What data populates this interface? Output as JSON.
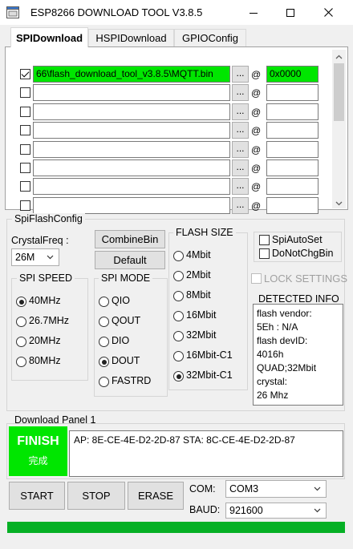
{
  "window": {
    "title": "ESP8266 DOWNLOAD TOOL V3.8.5",
    "minimize_label": "minimize",
    "maximize_label": "maximize",
    "close_label": "close"
  },
  "tabs": [
    {
      "label": "SPIDownload",
      "active": true
    },
    {
      "label": "HSPIDownload",
      "active": false
    },
    {
      "label": "GPIOConfig",
      "active": false
    }
  ],
  "file_rows": [
    {
      "checked": true,
      "path": "66\\flash_download_tool_v3.8.5\\MQTT.bin",
      "browse": "...",
      "at": "@",
      "address": "0x0000"
    },
    {
      "checked": false,
      "path": "",
      "browse": "...",
      "at": "@",
      "address": ""
    },
    {
      "checked": false,
      "path": "",
      "browse": "...",
      "at": "@",
      "address": ""
    },
    {
      "checked": false,
      "path": "",
      "browse": "...",
      "at": "@",
      "address": ""
    },
    {
      "checked": false,
      "path": "",
      "browse": "...",
      "at": "@",
      "address": ""
    },
    {
      "checked": false,
      "path": "",
      "browse": "...",
      "at": "@",
      "address": ""
    },
    {
      "checked": false,
      "path": "",
      "browse": "...",
      "at": "@",
      "address": ""
    },
    {
      "checked": false,
      "path": "",
      "browse": "...",
      "at": "@",
      "address": ""
    }
  ],
  "spi_flash_config": {
    "group_title": "SpiFlashConfig",
    "crystal_label": "CrystalFreq :",
    "crystal_value": "26M",
    "combine_bin": "CombineBin",
    "default": "Default",
    "spi_speed": {
      "title": "SPI SPEED",
      "options": [
        "40MHz",
        "26.7MHz",
        "20MHz",
        "80MHz"
      ],
      "selected": "40MHz"
    },
    "spi_mode": {
      "title": "SPI MODE",
      "options": [
        "QIO",
        "QOUT",
        "DIO",
        "DOUT",
        "FASTRD"
      ],
      "selected": "DOUT"
    },
    "flash_size": {
      "title": "FLASH SIZE",
      "options": [
        "4Mbit",
        "2Mbit",
        "8Mbit",
        "16Mbit",
        "32Mbit",
        "16Mbit-C1",
        "32Mbit-C1"
      ],
      "selected": "32Mbit-C1"
    },
    "spi_auto_set": "SpiAutoSet",
    "do_not_chg_bin": "DoNotChgBin",
    "lock_settings": "LOCK SETTINGS",
    "detected_info": {
      "title": "DETECTED INFO",
      "lines": [
        "flash vendor:",
        "5Eh : N/A",
        "flash devID:",
        "4016h",
        "QUAD;32Mbit",
        "crystal:",
        "26 Mhz"
      ]
    }
  },
  "download_panel": {
    "title": "Download Panel 1",
    "status": "FINISH",
    "status_sub": "完成",
    "mac_info": "AP:  8E-CE-4E-D2-2D-87   STA:  8C-CE-4E-D2-2D-87"
  },
  "controls": {
    "start": "START",
    "stop": "STOP",
    "erase": "ERASE",
    "com_label": "COM:",
    "com_value": "COM3",
    "baud_label": "BAUD:",
    "baud_value": "921600"
  },
  "progress": {
    "fraction": 1.0
  },
  "colors": {
    "success_green": "#00e600",
    "progress_green": "#06b025"
  }
}
